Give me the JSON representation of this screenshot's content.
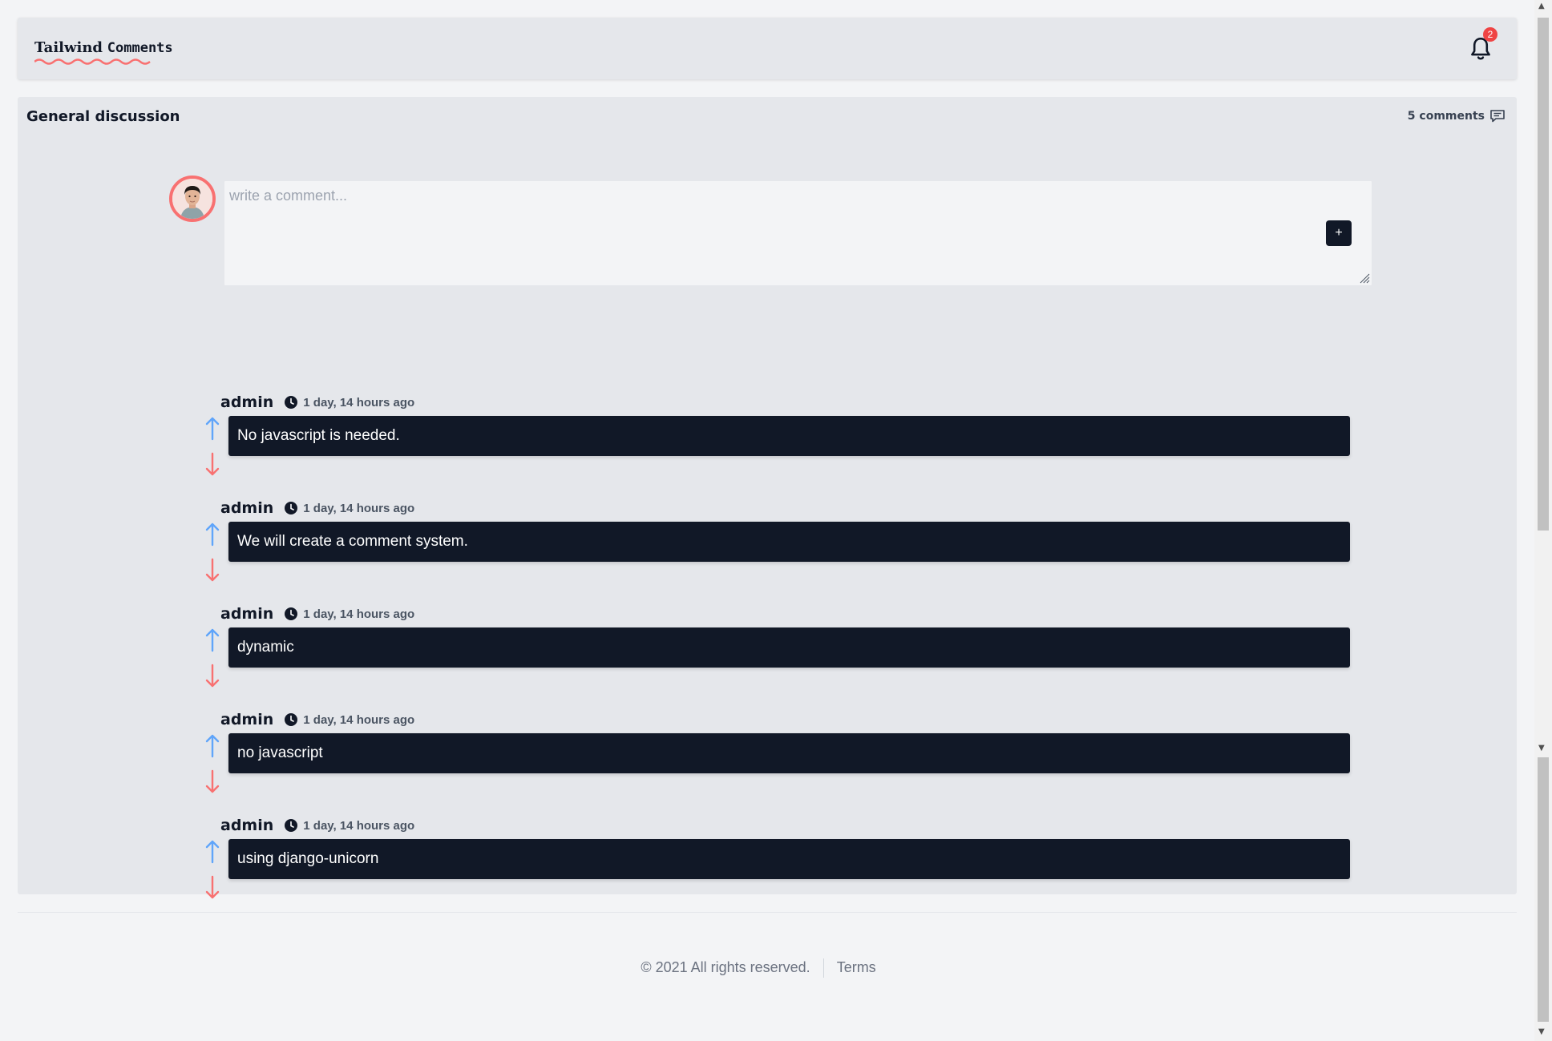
{
  "header": {
    "brand_part1": "Tailwind",
    "brand_part2": "Comments",
    "notification_count": "2"
  },
  "discussion": {
    "title": "General discussion",
    "comment_count_label": "5 comments",
    "input_placeholder": "write a comment...",
    "add_button_label": "+"
  },
  "comments": [
    {
      "author": "admin",
      "time": "1 day, 14 hours ago",
      "text": "No javascript is needed."
    },
    {
      "author": "admin",
      "time": "1 day, 14 hours ago",
      "text": "We will create a comment system."
    },
    {
      "author": "admin",
      "time": "1 day, 14 hours ago",
      "text": "dynamic"
    },
    {
      "author": "admin",
      "time": "1 day, 14 hours ago",
      "text": "no javascript"
    },
    {
      "author": "admin",
      "time": "1 day, 14 hours ago",
      "text": "using django-unicorn"
    }
  ],
  "footer": {
    "copyright": "© 2021 All rights reserved.",
    "terms_label": "Terms"
  },
  "icons": {
    "bell": "bell-icon",
    "comments": "chat-bubble-icon",
    "clock": "clock-icon",
    "upvote": "arrow-up-icon",
    "downvote": "arrow-down-icon"
  },
  "colors": {
    "upvote": "#60a5fa",
    "downvote": "#f87171",
    "comment_bg": "#111827",
    "badge": "#ef4444"
  }
}
